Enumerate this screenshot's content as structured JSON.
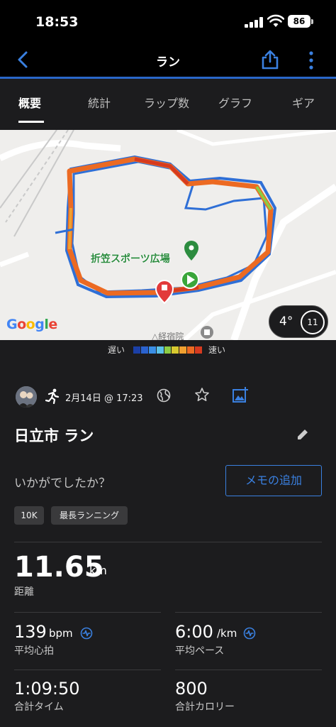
{
  "status": {
    "time": "18:53",
    "battery": "86"
  },
  "nav": {
    "title": "ラン"
  },
  "tabs": [
    "概要",
    "統計",
    "ラップ数",
    "グラフ",
    "ギア"
  ],
  "map": {
    "place_label": "折笠スポーツ広場",
    "place_label_partial": "△経宿院",
    "google": "Google"
  },
  "weather": {
    "temperature": "4°",
    "wind": "11"
  },
  "legend": {
    "slow": "遅い",
    "fast": "速い",
    "colors": [
      "#1b3fa6",
      "#2a62cf",
      "#3a8fe6",
      "#5cc2e8",
      "#8ccc44",
      "#d8c92f",
      "#f0a030",
      "#ec6a22",
      "#d63a1f"
    ]
  },
  "activity": {
    "date": "2月14日 @ 17:23",
    "title": "日立市 ラン",
    "prompt": "いかがでしたか？",
    "memo_button": "メモの追加",
    "badges": [
      "10K",
      "最長ランニング"
    ]
  },
  "stats": {
    "distance": {
      "value": "11.65",
      "unit": "km",
      "label": "距離"
    },
    "heart_rate": {
      "value": "139",
      "unit": "bpm",
      "label": "平均心拍"
    },
    "pace": {
      "value": "6:00",
      "unit": "/km",
      "label": "平均ペース"
    },
    "time": {
      "value": "1:09:50",
      "label": "合計タイム"
    },
    "calories": {
      "value": "800",
      "label": "合計カロリー"
    }
  },
  "colors": {
    "accent": "#3a80e0",
    "nav_line": "#2a67c9"
  }
}
